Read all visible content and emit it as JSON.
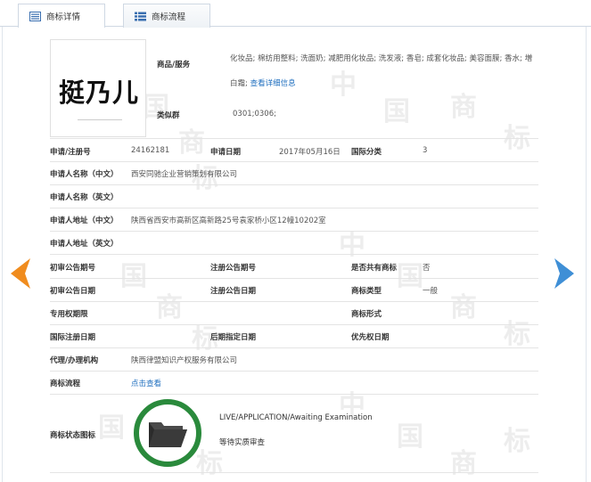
{
  "tabs": [
    {
      "label": "商标详情",
      "active": true,
      "icon": "list-doc-icon"
    },
    {
      "label": "商标流程",
      "active": false,
      "icon": "flow-list-icon"
    }
  ],
  "trademark": {
    "logo_text": "挺乃儿",
    "goods_label": "商品/服务",
    "goods_value": "化妆品; 棉纺用整料; 洗面奶; 减肥用化妆品; 洗发液; 香皂; 成套化妆品; 美容面膜; 香水; 増白霜;",
    "goods_link": "查看详细信息",
    "class_group_label": "类似群",
    "class_group_value": "0301;0306;"
  },
  "fields": {
    "reg_no_label": "申请/注册号",
    "reg_no_value": "24162181",
    "apply_date_label": "申请日期",
    "apply_date_value": "2017年05月16日",
    "intl_class_label": "国际分类",
    "intl_class_value": "3",
    "applicant_cn_label": "申请人名称（中文）",
    "applicant_cn_value": "西安同驰企业营销策划有限公司",
    "applicant_en_label": "申请人名称（英文）",
    "address_cn_label": "申请人地址（中文）",
    "address_cn_value": "陕西省西安市高新区高新路25号袁家桥小区12幢10202室",
    "address_en_label": "申请人地址（英文）",
    "prelim_no_label": "初审公告期号",
    "reg_notice_no_label": "注册公告期号",
    "shared_label": "是否共有商标",
    "shared_value": "否",
    "prelim_date_label": "初审公告日期",
    "reg_notice_date_label": "注册公告日期",
    "tm_type_label": "商标类型",
    "tm_type_value": "一般",
    "exclusive_label": "专用权期限",
    "tm_form_label": "商标形式",
    "intl_reg_date_label": "国际注册日期",
    "later_date_label": "后期指定日期",
    "priority_date_label": "优先权日期",
    "agent_label": "代理/办理机构",
    "agent_value": "陕西律盟知识产权服务有限公司",
    "process_label": "商标流程",
    "process_link": "点击查看",
    "status_label": "商标状态图标",
    "status_en": "LIVE/APPLICATION/Awaiting Examination",
    "status_cn": "等待实质审查"
  },
  "colors": {
    "arrow_left": "#f08c1e",
    "arrow_right": "#3f8fd6",
    "link": "#1f6fbf",
    "status_green": "#2a8a3c"
  }
}
